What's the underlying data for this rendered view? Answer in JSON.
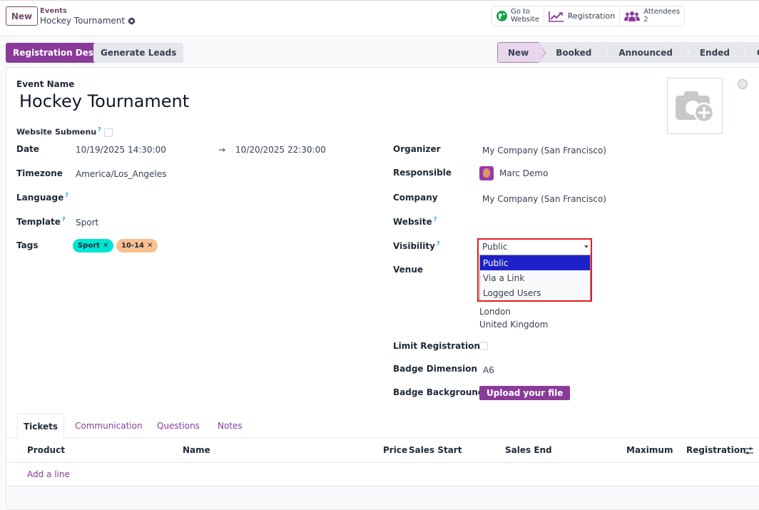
{
  "topbar": {
    "new_label": "New",
    "breadcrumb_parent": "Events",
    "breadcrumb_current": "Hockey Tournament",
    "smart_buttons": [
      {
        "label_line1": "Go to",
        "label_line2": "Website",
        "icon": "globe-icon"
      },
      {
        "label": "Registration",
        "icon": "chart-line-icon"
      },
      {
        "label": "Attendees",
        "value": "2",
        "icon": "users-icon"
      }
    ]
  },
  "controls": {
    "primary_action": "Registration Desk",
    "secondary_action": "Generate Leads",
    "stages": [
      "New",
      "Booked",
      "Announced",
      "Ended",
      "Cancelled"
    ],
    "active_stage": "New"
  },
  "form": {
    "event_name_label": "Event Name",
    "event_name": "Hockey Tournament",
    "website_submenu_label": "Website Submenu",
    "help_mark": "?",
    "left": {
      "date_label": "Date",
      "date_start": "10/19/2025 14:30:00",
      "date_arrow": "→",
      "date_end": "10/20/2025 22:30:00",
      "timezone_label": "Timezone",
      "timezone": "America/Los_Angeles",
      "language_label": "Language",
      "template_label": "Template",
      "template": "Sport",
      "tags_label": "Tags",
      "tags": [
        {
          "label": "Sport",
          "color": "#00e5d4"
        },
        {
          "label": "10-14",
          "color": "#fbbf8f"
        }
      ],
      "tag_remove": "✕"
    },
    "right": {
      "organizer_label": "Organizer",
      "organizer": "My Company (San Francisco)",
      "responsible_label": "Responsible",
      "responsible": "Marc Demo",
      "company_label": "Company",
      "company": "My Company (San Francisco)",
      "website_label": "Website",
      "visibility_label": "Visibility",
      "visibility_value": "Public",
      "visibility_options": [
        "Public",
        "Via a Link",
        "Logged Users"
      ],
      "venue_label": "Venue",
      "venue_city": "London",
      "venue_country": "United Kingdom",
      "limit_label": "Limit Registrations",
      "badge_dim_label": "Badge Dimension",
      "badge_dim": "A6",
      "badge_bg_label": "Badge Background",
      "upload_label": "Upload your file"
    }
  },
  "notebook": {
    "tabs": [
      "Tickets",
      "Communication",
      "Questions",
      "Notes"
    ],
    "active_tab": "Tickets",
    "columns": [
      "Product",
      "Name",
      "Price",
      "Sales Start",
      "Sales End",
      "Maximum",
      "Registration"
    ],
    "add_line": "Add a line"
  },
  "colors": {
    "brand": "#714b67",
    "primary_button": "#8a3b9a",
    "highlight_border": "#e11d1d",
    "selected_option": "#1e20c9"
  }
}
